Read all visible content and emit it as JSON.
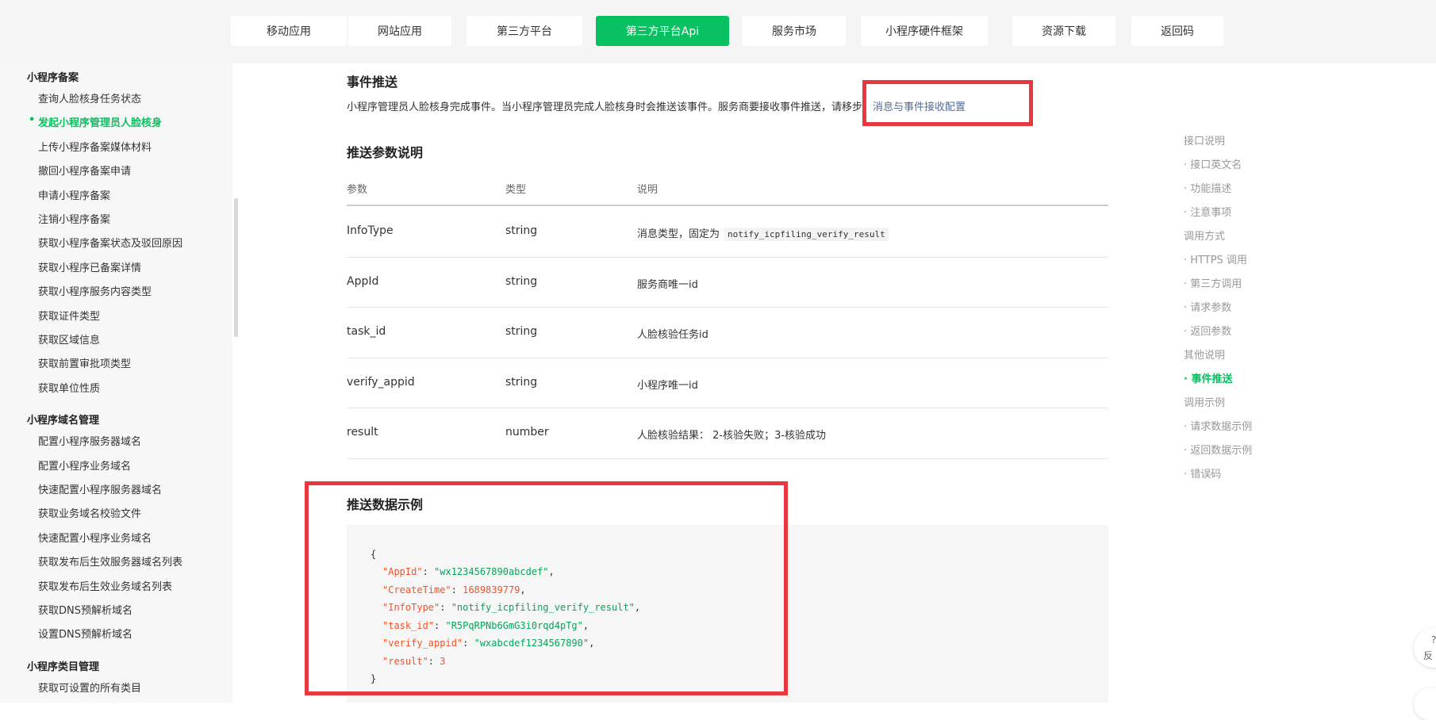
{
  "nav": {
    "tabs": [
      {
        "label": "移动应用"
      },
      {
        "label": "网站应用"
      },
      {
        "label": "第三方平台"
      },
      {
        "label": "第三方平台Api",
        "active": true
      },
      {
        "label": "服务市场"
      },
      {
        "label": "小程序硬件框架"
      },
      {
        "label": "资源下载"
      },
      {
        "label": "返回码"
      }
    ]
  },
  "sidebar": {
    "groups": [
      {
        "title": "小程序备案",
        "items": [
          "查询人脸核身任务状态",
          "发起小程序管理员人脸核身",
          "上传小程序备案媒体材料",
          "撤回小程序备案申请",
          "申请小程序备案",
          "注销小程序备案",
          "获取小程序备案状态及驳回原因",
          "获取小程序已备案详情",
          "获取小程序服务内容类型",
          "获取证件类型",
          "获取区域信息",
          "获取前置审批项类型",
          "获取单位性质"
        ]
      },
      {
        "title": "小程序域名管理",
        "items": [
          "配置小程序服务器域名",
          "配置小程序业务域名",
          "快速配置小程序服务器域名",
          "获取业务域名校验文件",
          "快速配置小程序业务域名",
          "获取发布后生效服务器域名列表",
          "获取发布后生效业务域名列表",
          "获取DNS预解析域名",
          "设置DNS预解析域名"
        ]
      },
      {
        "title": "小程序类目管理",
        "items": [
          "获取可设置的所有类目"
        ]
      }
    ],
    "active_item": "发起小程序管理员人脸核身"
  },
  "content": {
    "event_title": "事件推送",
    "event_desc": "小程序管理员人脸核身完成事件。当小程序管理员完成人脸核身时会推送该事件。服务商要接收事件推送，请移步：",
    "event_link": "消息与事件接收配置",
    "params_title": "推送参数说明",
    "table": {
      "headers": [
        "参数",
        "类型",
        "说明"
      ],
      "rows": [
        {
          "param": "InfoType",
          "type": "string",
          "desc": "消息类型，固定为",
          "code": "notify_icpfiling_verify_result"
        },
        {
          "param": "AppId",
          "type": "string",
          "desc": "服务商唯一id"
        },
        {
          "param": "task_id",
          "type": "string",
          "desc": "人脸核验任务id"
        },
        {
          "param": "verify_appid",
          "type": "string",
          "desc": "小程序唯一id"
        },
        {
          "param": "result",
          "type": "number",
          "desc": "人脸核验结果： 2-核验失败；3-核验成功"
        }
      ]
    },
    "example_title": "推送数据示例",
    "example": {
      "open": "{",
      "lines": [
        {
          "key": "\"AppId\"",
          "value": "\"wx1234567890abcdef\"",
          "kind": "s",
          "comma": ","
        },
        {
          "key": "\"CreateTime\"",
          "value": "1689839779",
          "kind": "n",
          "comma": ","
        },
        {
          "key": "\"InfoType\"",
          "value": "\"notify_icpfiling_verify_result\"",
          "kind": "s",
          "comma": ","
        },
        {
          "key": "\"task_id\"",
          "value": "\"R5PqRPNb6GmG3i0rqd4pTg\"",
          "kind": "s",
          "comma": ","
        },
        {
          "key": "\"verify_appid\"",
          "value": "\"wxabcdef1234567890\"",
          "kind": "s",
          "comma": ","
        },
        {
          "key": "\"result\"",
          "value": "3",
          "kind": "n",
          "comma": ""
        }
      ],
      "close": "}"
    }
  },
  "toc": {
    "items": [
      {
        "label": "接口说明",
        "level": 1
      },
      {
        "label": "· 接口英文名",
        "level": 2
      },
      {
        "label": "· 功能描述",
        "level": 2
      },
      {
        "label": "· 注意事项",
        "level": 2
      },
      {
        "label": "调用方式",
        "level": 1
      },
      {
        "label": "· HTTPS 调用",
        "level": 2
      },
      {
        "label": "· 第三方调用",
        "level": 2
      },
      {
        "label": "· 请求参数",
        "level": 2
      },
      {
        "label": "· 返回参数",
        "level": 2
      },
      {
        "label": "其他说明",
        "level": 1
      },
      {
        "label": "· 事件推送",
        "level": 2,
        "active": true
      },
      {
        "label": "调用示例",
        "level": 1
      },
      {
        "label": "· 请求数据示例",
        "level": 2
      },
      {
        "label": "· 返回数据示例",
        "level": 2
      },
      {
        "label": "· 错误码",
        "level": 2
      }
    ]
  },
  "floating": {
    "icon": "?",
    "label": "反"
  },
  "colors": {
    "accent": "#07c160",
    "highlight": "#e8373d",
    "link": "#576b95"
  }
}
